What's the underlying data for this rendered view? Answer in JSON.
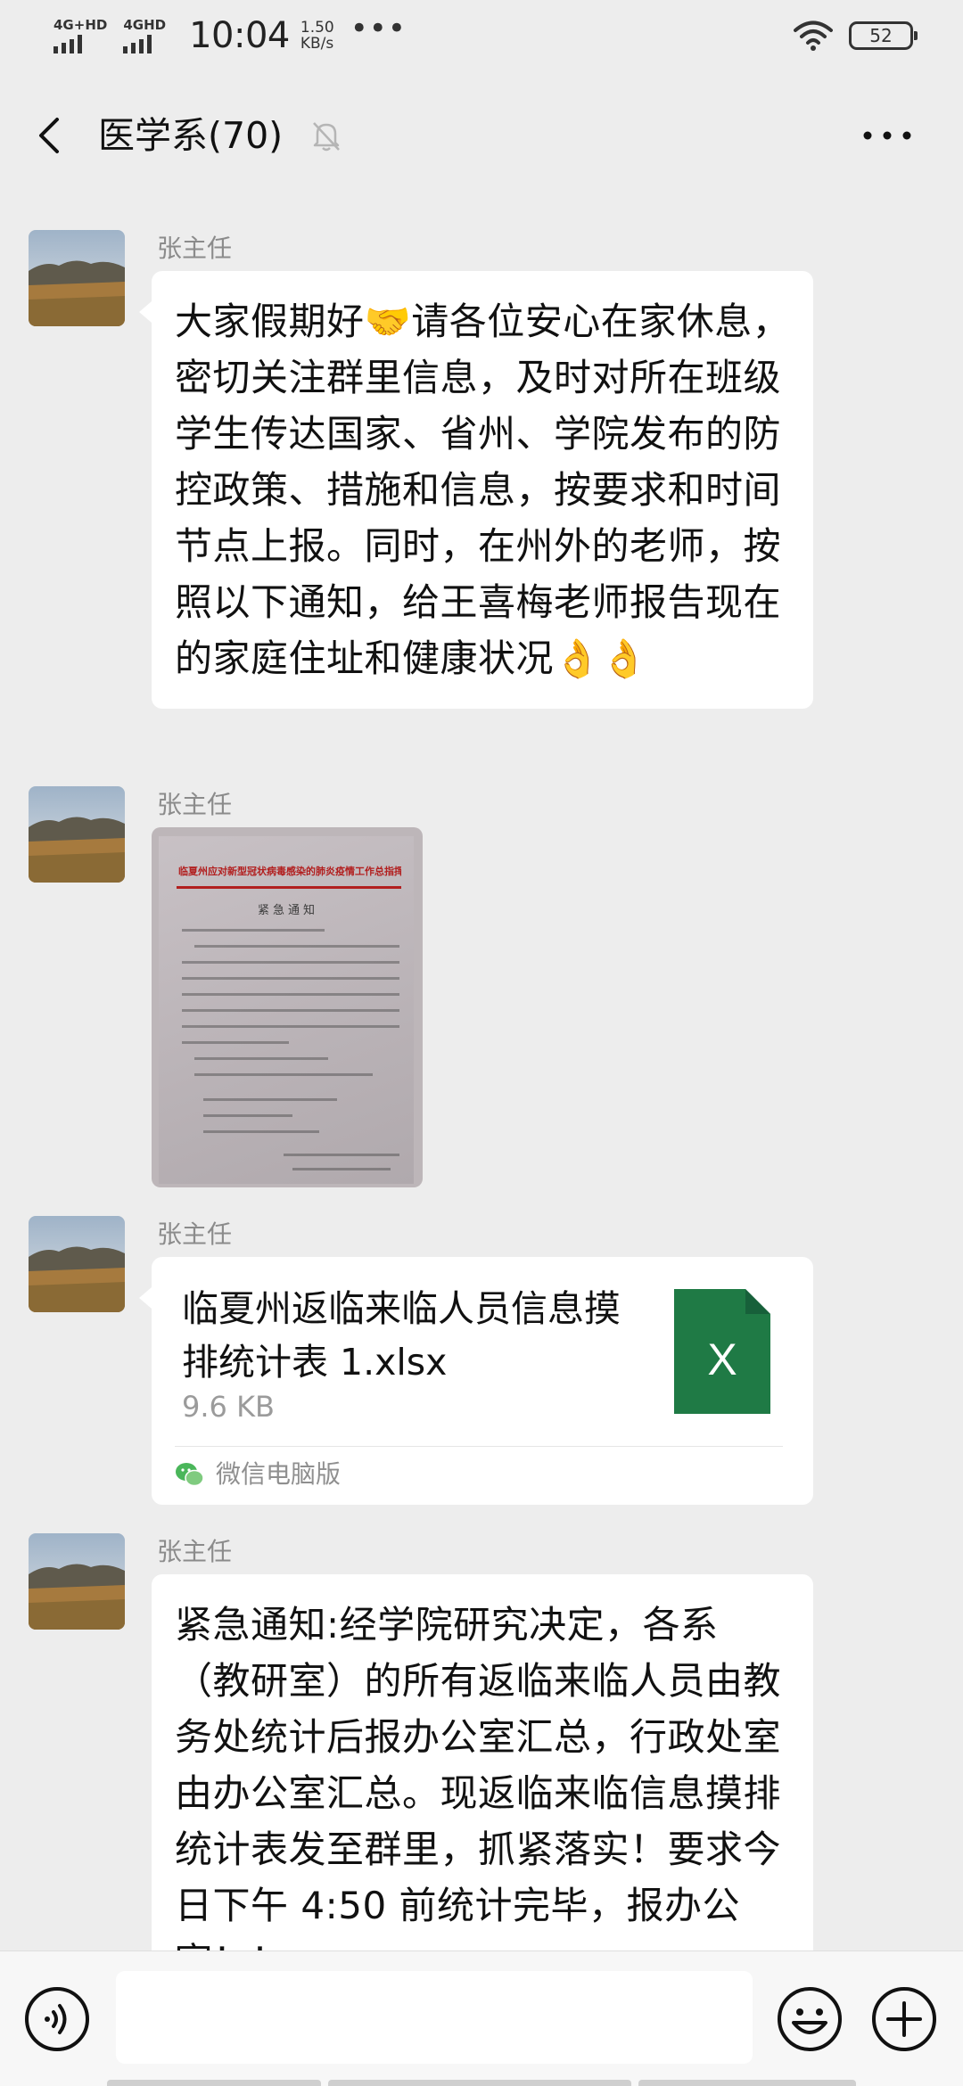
{
  "status_bar": {
    "sim1": "4G+HD",
    "sim2": "4GHD",
    "time": "10:04",
    "speed_value": "1.50",
    "speed_unit": "KB/s",
    "more": "•••",
    "battery": "52"
  },
  "header": {
    "title": "医学系(70)",
    "icons": [
      "back-icon",
      "mute-bell-icon",
      "more-icon"
    ]
  },
  "messages": [
    {
      "sender": "张主任",
      "type": "text",
      "text": "大家假期好🤝请各位安心在家休息，密切关注群里信息，及时对所在班级学生传达国家、省州、学院发布的防控政策、措施和信息，按要求和时间节点上报。同时，在州外的老师，按照以下通知，给王喜梅老师报告现在的家庭住址和健康状况👌👌"
    },
    {
      "sender": "张主任",
      "type": "image",
      "image": {
        "doc_title": "临夏州应对新型冠状病毒感染的肺炎疫情工作总指挥部办公室",
        "doc_heading": "紧急通知"
      }
    },
    {
      "sender": "张主任",
      "type": "file",
      "file": {
        "name": "临夏州返临来临人员信息摸排统计表 1.xlsx",
        "size": "9.6 KB",
        "source": "微信电脑版",
        "icon": "excel-icon",
        "icon_letter": "X",
        "icon_color": "#1f7a45"
      }
    },
    {
      "sender": "张主任",
      "type": "text",
      "text": "紧急通知:经学院研究决定，各系（教研室）的所有返临来临人员由教务处统计后报办公室汇总，行政处室由办公室汇总。现返临来临信息摸排统计表发至群里，抓紧落实！要求今日下午 4:50 前统计完毕，报办公室！！"
    }
  ],
  "input_bar": {
    "placeholder": "",
    "icons": [
      "voice-icon",
      "emoji-icon",
      "plus-icon"
    ]
  },
  "colors": {
    "background": "#ededed",
    "bubble": "#ffffff",
    "excel_green": "#1f7a45"
  }
}
